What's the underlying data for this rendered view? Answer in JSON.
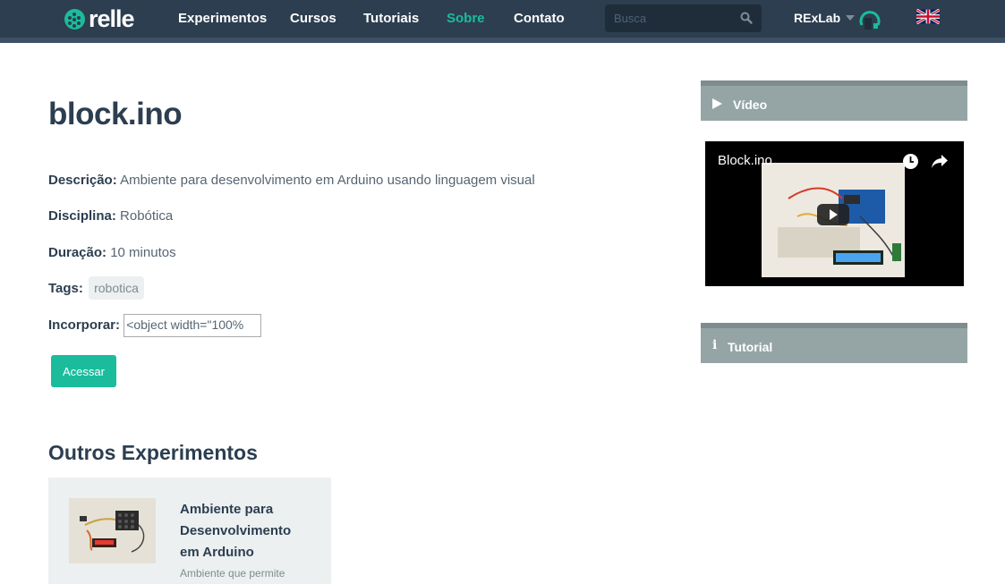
{
  "brand": {
    "name": "relle",
    "accent_color": "#1abc9c",
    "nav_bg": "#2c3e50"
  },
  "nav": {
    "items": [
      {
        "label": "Experimentos"
      },
      {
        "label": "Cursos"
      },
      {
        "label": "Tutoriais"
      },
      {
        "label": "Sobre",
        "active": true
      },
      {
        "label": "Contato"
      }
    ],
    "search_placeholder": "Busca",
    "search_icon": "search-icon",
    "lab_label": "RExLab",
    "language_icon": "uk-flag-icon"
  },
  "main": {
    "title": "block.ino",
    "description_label": "Descrição:",
    "description": "Ambiente para desenvolvimento em Arduino usando linguagem visual",
    "discipline_label": "Disciplina:",
    "discipline": "Robótica",
    "duration_label": "Duração:",
    "duration": "10 minutos",
    "tags_label": "Tags:",
    "tags": [
      "robotica"
    ],
    "embed_label": "Incorporar:",
    "embed_value": "<object width=\"100%",
    "access_button": "Acessar",
    "others_title": "Outros Experimentos",
    "others": [
      {
        "title": "Ambiente para Desenvolvimento em Arduino",
        "description": "Ambiente que permite"
      }
    ]
  },
  "sidebar": {
    "video_header": "Vídeo",
    "video_title": "Block.ino",
    "tutorial_header": "Tutorial"
  }
}
